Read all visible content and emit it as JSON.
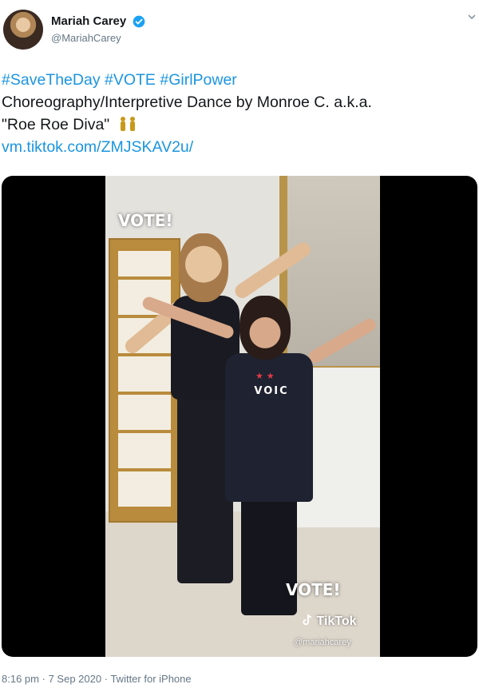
{
  "tweet": {
    "author": {
      "display_name": "Mariah Carey",
      "handle": "@MariahCarey",
      "verified": true
    },
    "text": {
      "line1_hashtags": [
        "#SaveTheDay",
        "#VOTE",
        "#GirlPower"
      ],
      "line2": "Choreography/Interpretive Dance by Monroe C. a.k.a.",
      "line3": "\"Roe Roe Diva\"",
      "line3_emoji": "gold-figures",
      "link": "vm.tiktok.com/ZMJSKAV2u/"
    },
    "media": {
      "overlay_top": "VOTE!",
      "overlay_bottom": "VOTE!",
      "shirt_text": "VOIC",
      "tiktok_label": "TikTok",
      "tiktok_handle": "@mariahcarey"
    },
    "footer": {
      "time": "8:16 pm",
      "date": "7 Sep 2020",
      "client": "Twitter for iPhone",
      "separator": "·"
    }
  },
  "colors": {
    "link": "#1b95e0",
    "verified": "#1da1f2",
    "muted": "#657786"
  },
  "icons": {
    "verified": "verified-badge-icon",
    "more": "chevron-down-icon",
    "tiktok": "tiktok-logo-icon"
  }
}
